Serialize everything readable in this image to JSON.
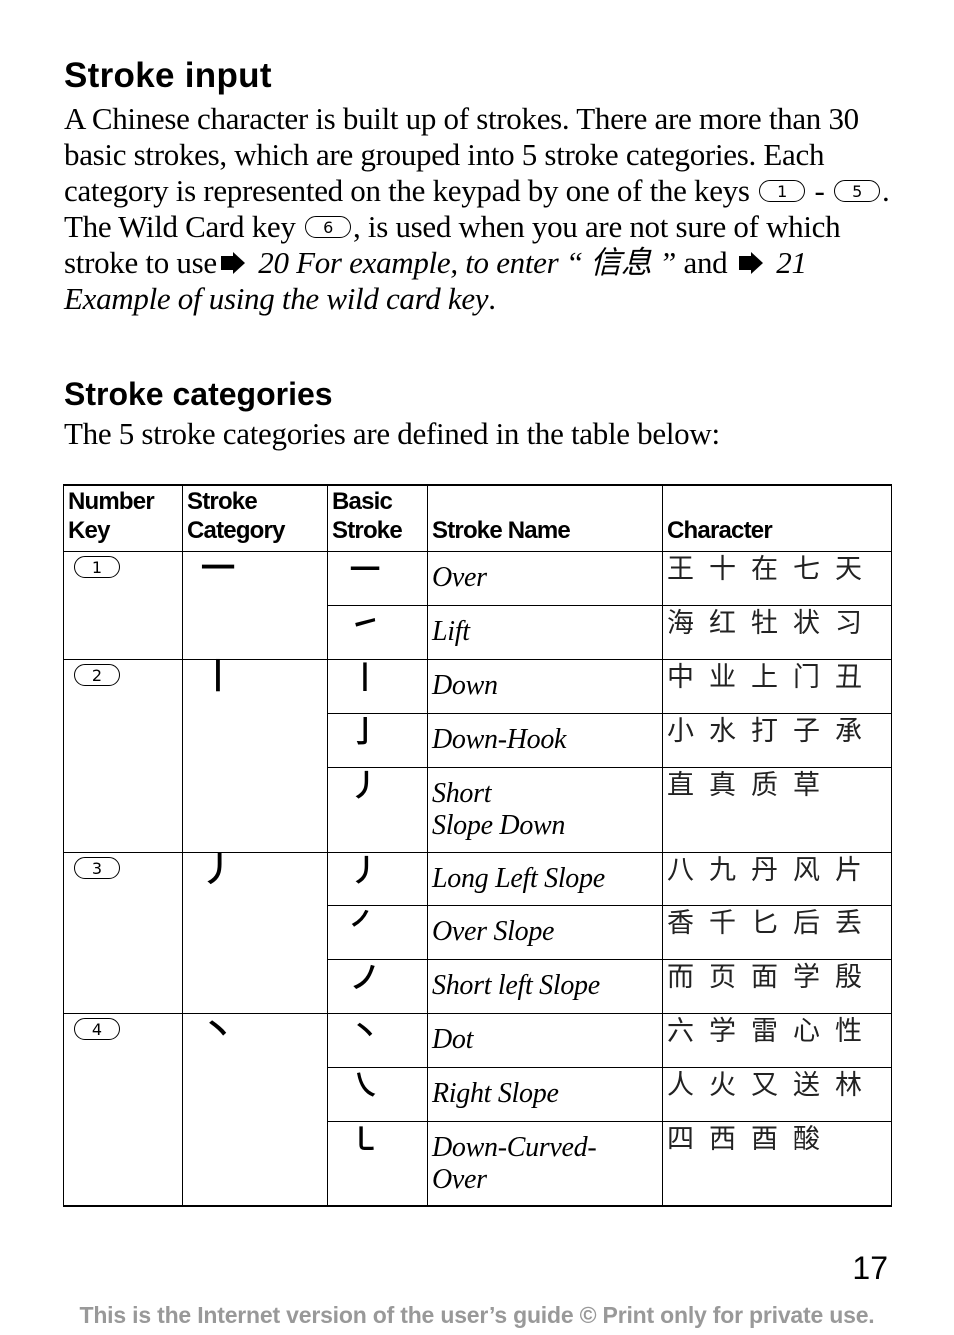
{
  "section1": {
    "title": "Stroke input",
    "p1": "A Chinese character is built up of strokes. There are more than 30 basic strokes, which are grouped into 5 stroke categories. Each category is represented on the keypad by one of the keys",
    "key_first": "1",
    "dash": "-",
    "key_last": "5",
    "p2": ". The Wild Card key",
    "key_wild": "6",
    "p3": ", is used when you are not sure of which stroke to use",
    "ref1": "20 For example, to enter “ 信息 ”",
    "and": "and",
    "ref2": "21 Example of using the wild card key",
    "period": "."
  },
  "section2": {
    "title": "Stroke categories",
    "intro": "The 5 stroke categories are defined in the table below:"
  },
  "table": {
    "headers": {
      "number_key_1": "Number",
      "number_key_2": "Key",
      "category_1": "Stroke",
      "category_2": "Category",
      "basic_1": "Basic",
      "basic_2": "Stroke",
      "name": "Stroke Name",
      "character": "Character"
    },
    "groups": [
      {
        "key": "1",
        "category_stroke": "一",
        "rows": [
          {
            "stroke": "一",
            "name": "Over",
            "chars": "王十在七天"
          },
          {
            "stroke": "㇀",
            "name": "Lift",
            "chars": "海红牡状习"
          }
        ]
      },
      {
        "key": "2",
        "category_stroke": "丨",
        "rows": [
          {
            "stroke": "丨",
            "name": "Down",
            "chars": "中业上门丑"
          },
          {
            "stroke": "亅",
            "name": "Down-Hook",
            "chars": "小水打子承"
          },
          {
            "stroke": "丿",
            "name": "Short Slope Down",
            "name_line1": "Short",
            "name_line2": "Slope Down",
            "chars": "直真质草"
          }
        ]
      },
      {
        "key": "3",
        "category_stroke": "丿",
        "rows": [
          {
            "stroke": "丿",
            "name": "Long Left Slope",
            "chars": "八九丹风片"
          },
          {
            "stroke": "㇒",
            "name": "Over Slope",
            "chars": "香千匕后丢"
          },
          {
            "stroke": "ノ",
            "name": "Short left Slope",
            "chars": "而页面学殷"
          }
        ]
      },
      {
        "key": "4",
        "category_stroke": "丶",
        "rows": [
          {
            "stroke": "丶",
            "name": "Dot",
            "chars": "六学雷心性"
          },
          {
            "stroke": "㇏",
            "name": "Right Slope",
            "chars": "人火又送林"
          },
          {
            "stroke": "㇄",
            "name": "Down-Curved-Over",
            "name_line1": "Down-Curved-",
            "name_line2": "Over",
            "chars": "四西酉酸"
          }
        ]
      }
    ]
  },
  "page_number": "17",
  "footer": "This is the Internet version of the user’s guide © Print only for private use."
}
